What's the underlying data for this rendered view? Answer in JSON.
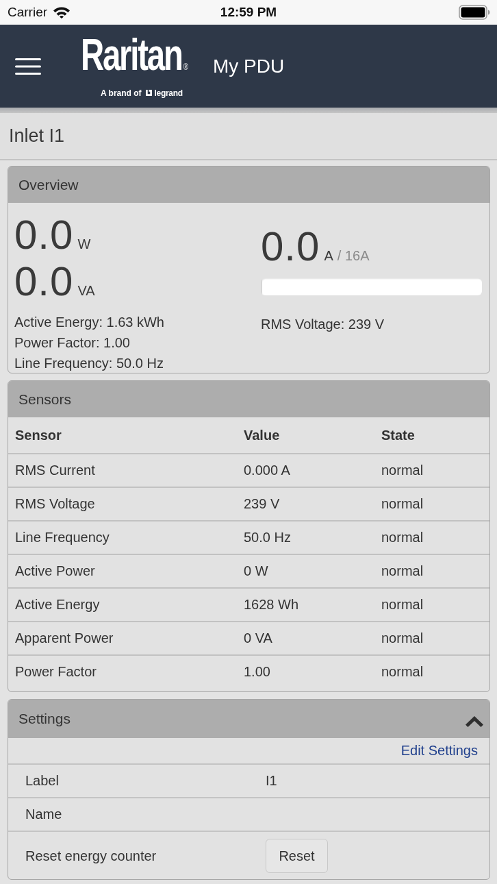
{
  "status_bar": {
    "carrier": "Carrier",
    "time": "12:59 PM"
  },
  "header": {
    "logo": {
      "wordmark": "Raritan",
      "mark": "®",
      "tagline": "A brand of",
      "brand": "legrand"
    },
    "title": "My PDU"
  },
  "page_title": "Inlet I1",
  "overview": {
    "title": "Overview",
    "readings": [
      {
        "value": "0.0",
        "unit": "W"
      },
      {
        "value": "0.0",
        "unit": "VA"
      }
    ],
    "current": {
      "value": "0.0",
      "unit": "A",
      "limit": "/ 16A",
      "level": 0
    },
    "details_left": [
      "Active Energy: 1.63 kWh",
      "Power Factor: 1.00",
      "Line Frequency: 50.0 Hz"
    ],
    "details_right": [
      "RMS Voltage: 239 V"
    ]
  },
  "sensors": {
    "title": "Sensors",
    "columns": [
      "Sensor",
      "Value",
      "State"
    ],
    "rows": [
      [
        "RMS Current",
        "0.000 A",
        "normal"
      ],
      [
        "RMS Voltage",
        "239 V",
        "normal"
      ],
      [
        "Line Frequency",
        "50.0 Hz",
        "normal"
      ],
      [
        "Active Power",
        "0 W",
        "normal"
      ],
      [
        "Active Energy",
        "1628 Wh",
        "normal"
      ],
      [
        "Apparent Power",
        "0 VA",
        "normal"
      ],
      [
        "Power Factor",
        "1.00",
        "normal"
      ]
    ]
  },
  "settings": {
    "title": "Settings",
    "expanded": true,
    "edit_link": "Edit Settings",
    "rows": [
      {
        "kind": "field",
        "label": "Label",
        "value": "I1"
      },
      {
        "kind": "field",
        "label": "Name"
      },
      {
        "kind": "action",
        "label": "Reset energy counter",
        "button": "Reset"
      }
    ]
  }
}
